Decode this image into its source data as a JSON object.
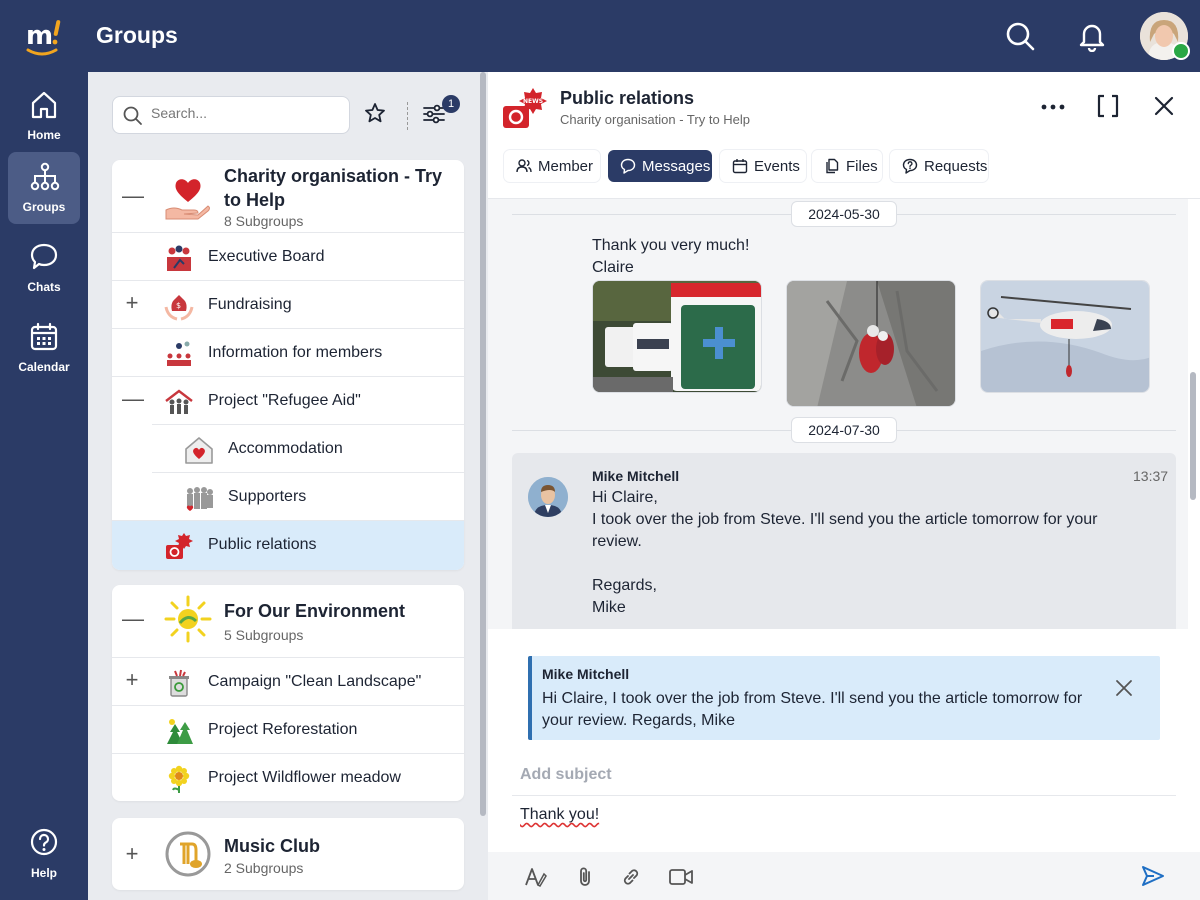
{
  "app": {
    "title": "Groups"
  },
  "nav": {
    "items": [
      {
        "label": "Home",
        "icon": "home-icon"
      },
      {
        "label": "Groups",
        "icon": "org-chart-icon",
        "active": true
      },
      {
        "label": "Chats",
        "icon": "chat-bubble-icon"
      },
      {
        "label": "Calendar",
        "icon": "calendar-icon"
      }
    ],
    "help_label": "Help"
  },
  "group_panel": {
    "search_placeholder": "Search...",
    "filter_count": "1",
    "groups": [
      {
        "name": "Charity organisation - Try to Help",
        "subgroups_label": "8 Subgroups",
        "toggle": "—",
        "subgroups": [
          {
            "label": "Executive Board",
            "toggle": ""
          },
          {
            "label": "Fundraising",
            "toggle": "+"
          },
          {
            "label": "Information for members",
            "toggle": ""
          },
          {
            "label": "Project \"Refugee Aid\"",
            "toggle": "—"
          },
          {
            "label": "Accommodation",
            "toggle": "",
            "nested": true
          },
          {
            "label": "Supporters",
            "toggle": "",
            "nested": true
          },
          {
            "label": "Public relations",
            "toggle": "",
            "selected": true
          }
        ]
      },
      {
        "name": "For Our Environment",
        "subgroups_label": "5 Subgroups",
        "toggle": "—",
        "subgroups": [
          {
            "label": "Campaign \"Clean Landscape\"",
            "toggle": "+"
          },
          {
            "label": "Project Reforestation",
            "toggle": ""
          },
          {
            "label": "Project Wildflower meadow",
            "toggle": ""
          }
        ]
      },
      {
        "name": "Music Club",
        "subgroups_label": "2 Subgroups",
        "toggle": "+"
      }
    ]
  },
  "detail": {
    "badge_text": "NEWS",
    "title": "Public relations",
    "subtitle": "Charity organisation - Try to Help",
    "tabs": [
      {
        "label": "Member",
        "icon": "people-icon"
      },
      {
        "label": "Messages",
        "icon": "speech-bubble-icon",
        "active": true
      },
      {
        "label": "Events",
        "icon": "calendar-icon"
      },
      {
        "label": "Files",
        "icon": "files-icon"
      },
      {
        "label": "Requests",
        "icon": "question-bubble-icon"
      }
    ],
    "messages": {
      "date1": "2024-05-30",
      "msg1_line1": "Thank you very much!",
      "msg1_line2": "Claire",
      "date2": "2024-07-30",
      "msg2": {
        "sender": "Mike Mitchell",
        "time": "13:37",
        "line1": "Hi Claire,",
        "line2": "I took over the job from Steve. I'll send you the article tomorrow for your",
        "line3": "review.",
        "line4": "Regards,",
        "line5": "Mike"
      }
    },
    "compose": {
      "quote_sender": "Mike Mitchell",
      "quote_text": "Hi Claire, I took over the job from Steve. I'll send you the article tomorrow for your review. Regards, Mike",
      "subject_placeholder": "Add subject",
      "body": "Thank you!"
    }
  },
  "colors": {
    "navy": "#2b3b66",
    "nav_active": "#4c5c86",
    "selected_row": "#d9ebfa",
    "quote_border": "#2f6fb0",
    "heart_red": "#d3242b",
    "send_blue": "#1f6fc4"
  }
}
